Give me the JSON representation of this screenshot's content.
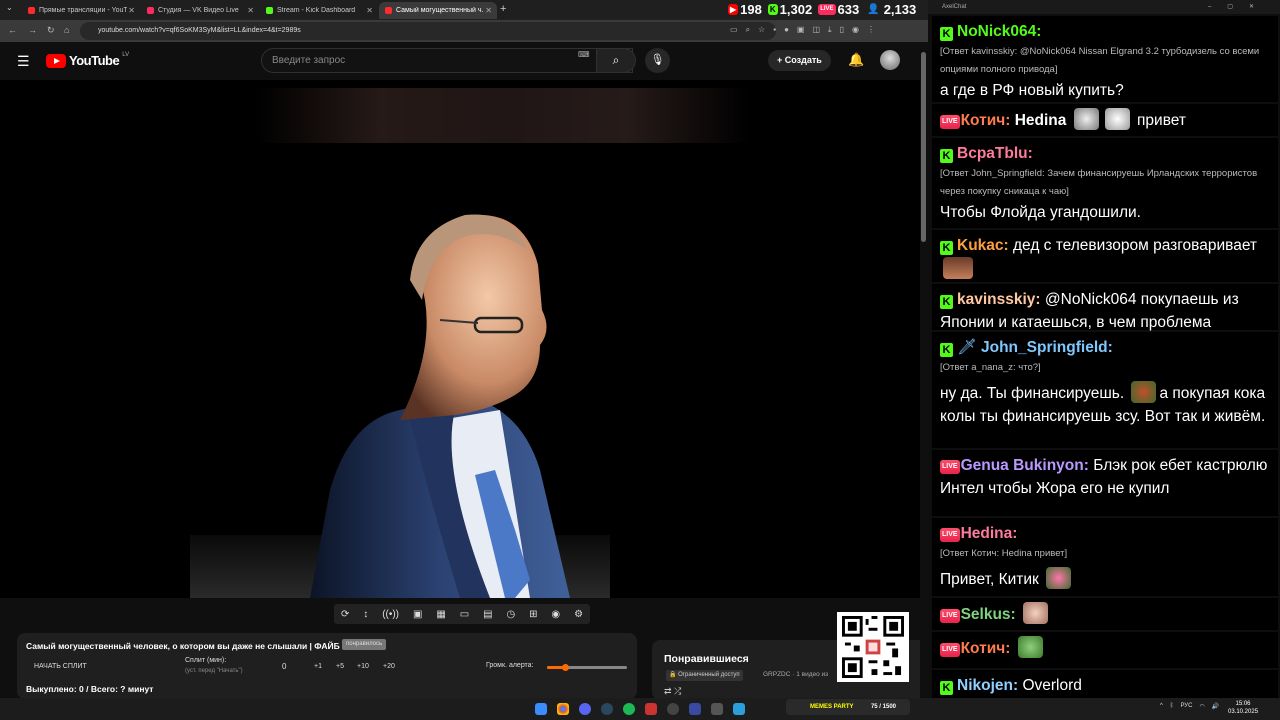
{
  "browser": {
    "tabs": [
      {
        "title": "Прямые трансляции - YouTube",
        "icon_color": "#ff2b2b"
      },
      {
        "title": "Студия — VK Видео Live",
        "icon_color": "#ff2b5e"
      },
      {
        "title": "Stream - Kick Dashboard",
        "icon_color": "#53fc18"
      },
      {
        "title": "Самый могущественный ч...",
        "icon_color": "#ff2b2b"
      }
    ],
    "url": "youtube.com/watch?v=qf6SoKM3SyM&list=LL&index=4&t=2989s"
  },
  "viewer_stats": [
    {
      "platform": "youtube",
      "icon": "▶",
      "color": "#ff0000",
      "value": "198"
    },
    {
      "platform": "kick",
      "icon": "K",
      "color": "#53fc18",
      "value": "1,302"
    },
    {
      "platform": "vk",
      "icon": "LIVE",
      "color": "#ff2b5e",
      "value": "633"
    },
    {
      "platform": "total",
      "icon": "👤",
      "color": "#4a8cff",
      "value": "2,133"
    }
  ],
  "youtube": {
    "logo": "YouTube",
    "country": "LV",
    "search_placeholder": "Введите запрос",
    "create_label": "Создать"
  },
  "player_controls": [
    "⟳",
    "↕",
    "((•))",
    "▣",
    "▦",
    "▭",
    "▤",
    "◷",
    "⊞",
    "◉",
    "⚙"
  ],
  "overlay": {
    "video_title": "Самый могущественный человек, о котором вы даже не слышали | ФАЙБ",
    "badge": "понравилось",
    "start_split": "НАЧАТЬ СПЛИТ",
    "split_label": "Сплит (мин):",
    "split_hint": "(уст. перед \"Начать\")",
    "split_value": "0",
    "split_buttons": [
      "+1",
      "+5",
      "+10",
      "+20"
    ],
    "alert_volume_label": "Громк. алерта:",
    "alert_volume_level": 0.22,
    "bought": "Выкуплено: 0 / Всего: ? минут"
  },
  "playlist": {
    "title": "Понравившиеся",
    "limited": "Ограниченный доступ",
    "channel": "GRPZDC · 1 видео из"
  },
  "chat": {
    "window_title": "AxelChat",
    "messages": [
      {
        "platform": "kick",
        "name": "NoNick064:",
        "color": "#53fc18",
        "reply": "[Ответ kavinsskiy: @NoNick064 Nissan Elgrand 3.2 турбодизель со всеми опциями полного привода]",
        "text": "а где в РФ новый купить?"
      },
      {
        "platform": "vk",
        "name": "Котич:",
        "color": "#ff7b50",
        "text_before": "Hedina",
        "text": "привет"
      },
      {
        "platform": "kick",
        "name": "BcpaTblu:",
        "color": "#ff7b9c",
        "reply": "[Ответ John_Springfield: Зачем финансируешь Ирландских террористов через покупку сникаца к чаю]",
        "text": "Чтобы Флойда угандошили."
      },
      {
        "platform": "kick",
        "name": "Kukac:",
        "color": "#ffa040",
        "text": "дед с телевизором разговаривает"
      },
      {
        "platform": "kick",
        "name": "kavinsskiy:",
        "color": "#ffc8a0",
        "text": "@NoNick064 покупаешь из Японии и катаешься, в чем проблема"
      },
      {
        "platform": "kick",
        "name": "John_Springfield:",
        "color": "#7fc8ff",
        "reply": "[Ответ a_nana_z: что?]",
        "text": "ну да. Ты финансируешь.",
        "text_after": "а покупая кока колы ты финансируешь зсу. Вот так и живём."
      },
      {
        "platform": "vk",
        "name": "Genua Bukinyon:",
        "color": "#b89aff",
        "text": "Блэк рок ебет кастрюлю Интел чтобы Жора его не купил"
      },
      {
        "platform": "vk",
        "name": "Hedina:",
        "color": "#ff7b9c",
        "reply": "[Ответ Котич: Hedina привет]",
        "text": "Привет, Китик"
      },
      {
        "platform": "vk",
        "name": "Selkus:",
        "color": "#7fd37f",
        "text": ""
      },
      {
        "platform": "vk",
        "name": "Котич:",
        "color": "#ff7b50",
        "text": ""
      },
      {
        "platform": "kick",
        "name": "Nikojen:",
        "color": "#8fd0ff",
        "text": "Overlord"
      }
    ]
  },
  "taskbar": {
    "memes_label": "MEMES PARTY",
    "memes_count": "75 / 1500",
    "lang": "РУС",
    "time": "15:06",
    "date": "03.10.2025"
  }
}
